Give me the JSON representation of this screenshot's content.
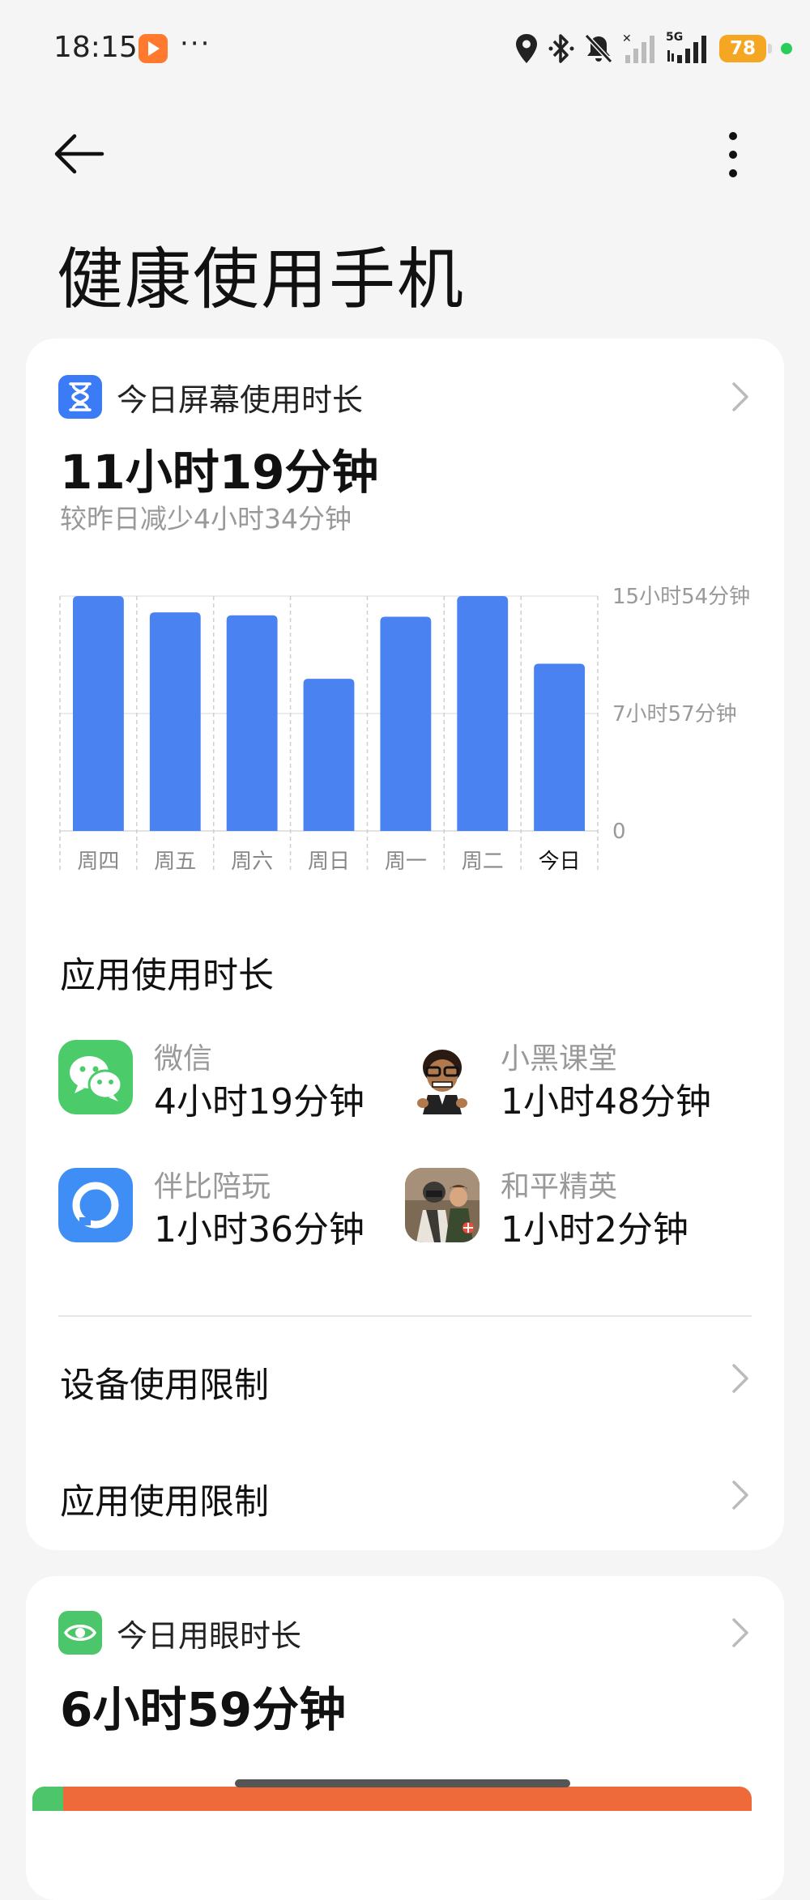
{
  "status_bar": {
    "time": "18:15",
    "more": "···",
    "network": "5G",
    "battery": "78",
    "icons": [
      "location-icon",
      "bluetooth-icon",
      "mute-icon",
      "signal-icon",
      "signal-5g-icon",
      "battery-icon"
    ]
  },
  "page": {
    "title": "健康使用手机"
  },
  "screen_time": {
    "header": "今日屏幕使用时长",
    "total": "11小时19分钟",
    "compare": "较昨日减少4小时34分钟",
    "y_axis": [
      "15小时54分钟",
      "7小时57分钟",
      "0"
    ],
    "colors": {
      "bar": "#4a82f2",
      "grid": "#d9d9d9"
    }
  },
  "chart_data": {
    "type": "bar",
    "categories": [
      "周四",
      "周五",
      "周六",
      "周日",
      "周一",
      "周二",
      "今日"
    ],
    "values": [
      15.9,
      14.8,
      14.6,
      10.3,
      14.5,
      15.9,
      11.32
    ],
    "ylim": [
      0,
      15.9
    ],
    "y_ticks": [
      "0",
      "7小时57分钟",
      "15小时54分钟"
    ],
    "highlight": "今日"
  },
  "app_usage": {
    "title": "应用使用时长",
    "apps": [
      {
        "name": "微信",
        "time": "4小时19分钟",
        "icon": "wechat-icon"
      },
      {
        "name": "小黑课堂",
        "time": "1小时48分钟",
        "icon": "xiaohei-ketang-icon"
      },
      {
        "name": "伴比陪玩",
        "time": "1小时36分钟",
        "icon": "banbi-peiwan-icon"
      },
      {
        "name": "和平精英",
        "time": "1小时2分钟",
        "icon": "peace-elite-icon"
      }
    ]
  },
  "limits": {
    "device": "设备使用限制",
    "app": "应用使用限制"
  },
  "eye_time": {
    "header": "今日用眼时长",
    "total": "6小时59分钟"
  }
}
